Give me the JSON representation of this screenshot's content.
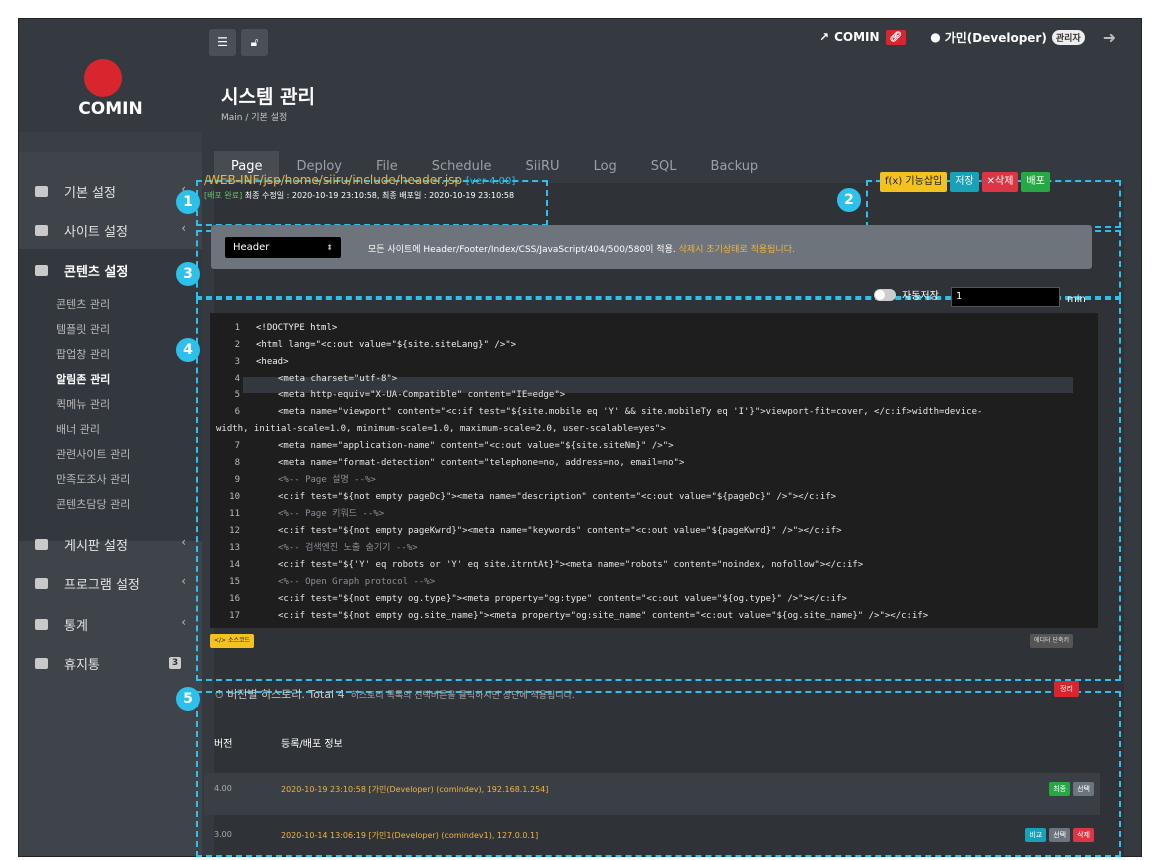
{
  "sidebar": {
    "logo_text": "COMIN",
    "items": [
      {
        "label": "기본 설정",
        "chevron": "‹"
      },
      {
        "label": "사이트 설정",
        "chevron": "‹"
      },
      {
        "label": "콘텐츠 설정"
      },
      {
        "label": "게시판 설정",
        "chevron": "‹"
      },
      {
        "label": "프로그램 설정",
        "chevron": "‹"
      },
      {
        "label": "통계",
        "chevron": "‹"
      },
      {
        "label": "휴지통",
        "badge": "3"
      }
    ],
    "sub_items": [
      "콘텐츠 관리",
      "템플릿 관리",
      "팝업창 관리",
      "알림존 관리",
      "퀵메뉴 관리",
      "배너 관리",
      "관련사이트 관리",
      "만족도조사 관리",
      "콘텐츠담당 관리"
    ]
  },
  "header": {
    "site_link": "COMIN",
    "user": "가민(Developer)",
    "role": "관리자"
  },
  "page": {
    "title": "시스템 관리",
    "breadcrumb": "Main / 기본 설정"
  },
  "tabs": [
    "Page",
    "Deploy",
    "File",
    "Schedule",
    "SiiRU",
    "Log",
    "SQL",
    "Backup"
  ],
  "file": {
    "path": "/WEB-INF/jsp/home/siiru/include/header.jsp",
    "version": "[ver 4.00]",
    "status": "[배포 완료]",
    "info": "최종 수정일 : 2020-10-19 23:10:58, 최종 배포일 : 2020-10-19 23:10:58"
  },
  "toolbar": {
    "insert": "f(x) 기능삽입",
    "save": "저장",
    "delete": "✕삭제",
    "deploy": "배포"
  },
  "template": {
    "selected": "Header",
    "note": "모든 사이트에 Header/Footer/Index/CSS/JavaScript/404/500/580이 적용.",
    "warn": "삭제시 초기상태로 적용됩니다."
  },
  "autosave": {
    "label": "자동저장",
    "value": "1",
    "unit": "min"
  },
  "editor": {
    "line_numbers": [
      "1",
      "2",
      "3",
      "4",
      "5",
      "6",
      "",
      "7",
      "8",
      "9",
      "10",
      "11",
      "12",
      "13",
      "14",
      "15",
      "16",
      "17"
    ],
    "lines": [
      "<!DOCTYPE html>",
      "<html lang=\"<c:out value=\"${site.siteLang}\" />\">",
      "<head>",
      "<meta charset=\"utf-8\">",
      "<meta http-equiv=\"X-UA-Compatible\" content=\"IE=edge\">",
      "<meta name=\"viewport\" content=\"<c:if test=\"${site.mobile eq 'Y' && site.mobileTy eq 'I'}\">viewport-fit=cover, </c:if>width=device-",
      "width, initial-scale=1.0, minimum-scale=1.0, maximum-scale=2.0, user-scalable=yes\">",
      "<meta name=\"application-name\" content=\"<c:out value=\"${site.siteNm}\" />\">",
      "<meta name=\"format-detection\" content=\"telephone=no, address=no, email=no\">",
      "<%-- Page 설명 --%>",
      "<c:if test=\"${not empty pageDc}\"><meta name=\"description\" content=\"<c:out value=\"${pageDc}\" />\"></c:if>",
      "<%-- Page 키워드 --%>",
      "<c:if test=\"${not empty pageKwrd}\"><meta name=\"keywords\" content=\"<c:out value=\"${pageKwrd}\" />\"></c:if>",
      "<%-- 검색엔진 노출 숨기기 --%>",
      "<c:if test=\"${'Y' eq robots or 'Y' eq site.itrntAt}\"><meta name=\"robots\" content=\"noindex, nofollow\"></c:if>",
      "<%-- Open Graph protocol --%>",
      "<c:if test=\"${not empty og.type}\"><meta property=\"og:type\" content=\"<c:out value=\"${og.type}\" />\"></c:if>",
      "<c:if test=\"${not empty og.site_name}\"><meta property=\"og:site_name\" content=\"<c:out value=\"${og.site_name}\" />\"></c:if>"
    ]
  },
  "editor_buttons": {
    "source": "</> 소스코드",
    "shrink": "에디터 단축키"
  },
  "history": {
    "title": "버전별 히스토리. Total 4",
    "subtitle": "히스토리 목록의 선택버튼을 클릭하시면 상단에 적용됩니다.",
    "sort": "정리",
    "col_version": "버전",
    "col_info": "등록/배포 정보",
    "rows": [
      {
        "version": "4.00",
        "info": "2020-10-19 23:10:58 [가민(Developer) (comindev), 192.168.1.254]",
        "buttons": [
          "최종",
          "선택"
        ]
      },
      {
        "version": "3.00",
        "info": "2020-10-14 13:06:19 [가민1(Developer) (comindev1), 127.0.0.1]",
        "buttons": [
          "비교",
          "선택",
          "삭제"
        ]
      }
    ]
  },
  "markers": [
    "1",
    "2",
    "3",
    "4",
    "5"
  ],
  "colors": {
    "accent": "#2cc0ea",
    "brand": "#d9252e",
    "warning": "#f0b43d"
  }
}
